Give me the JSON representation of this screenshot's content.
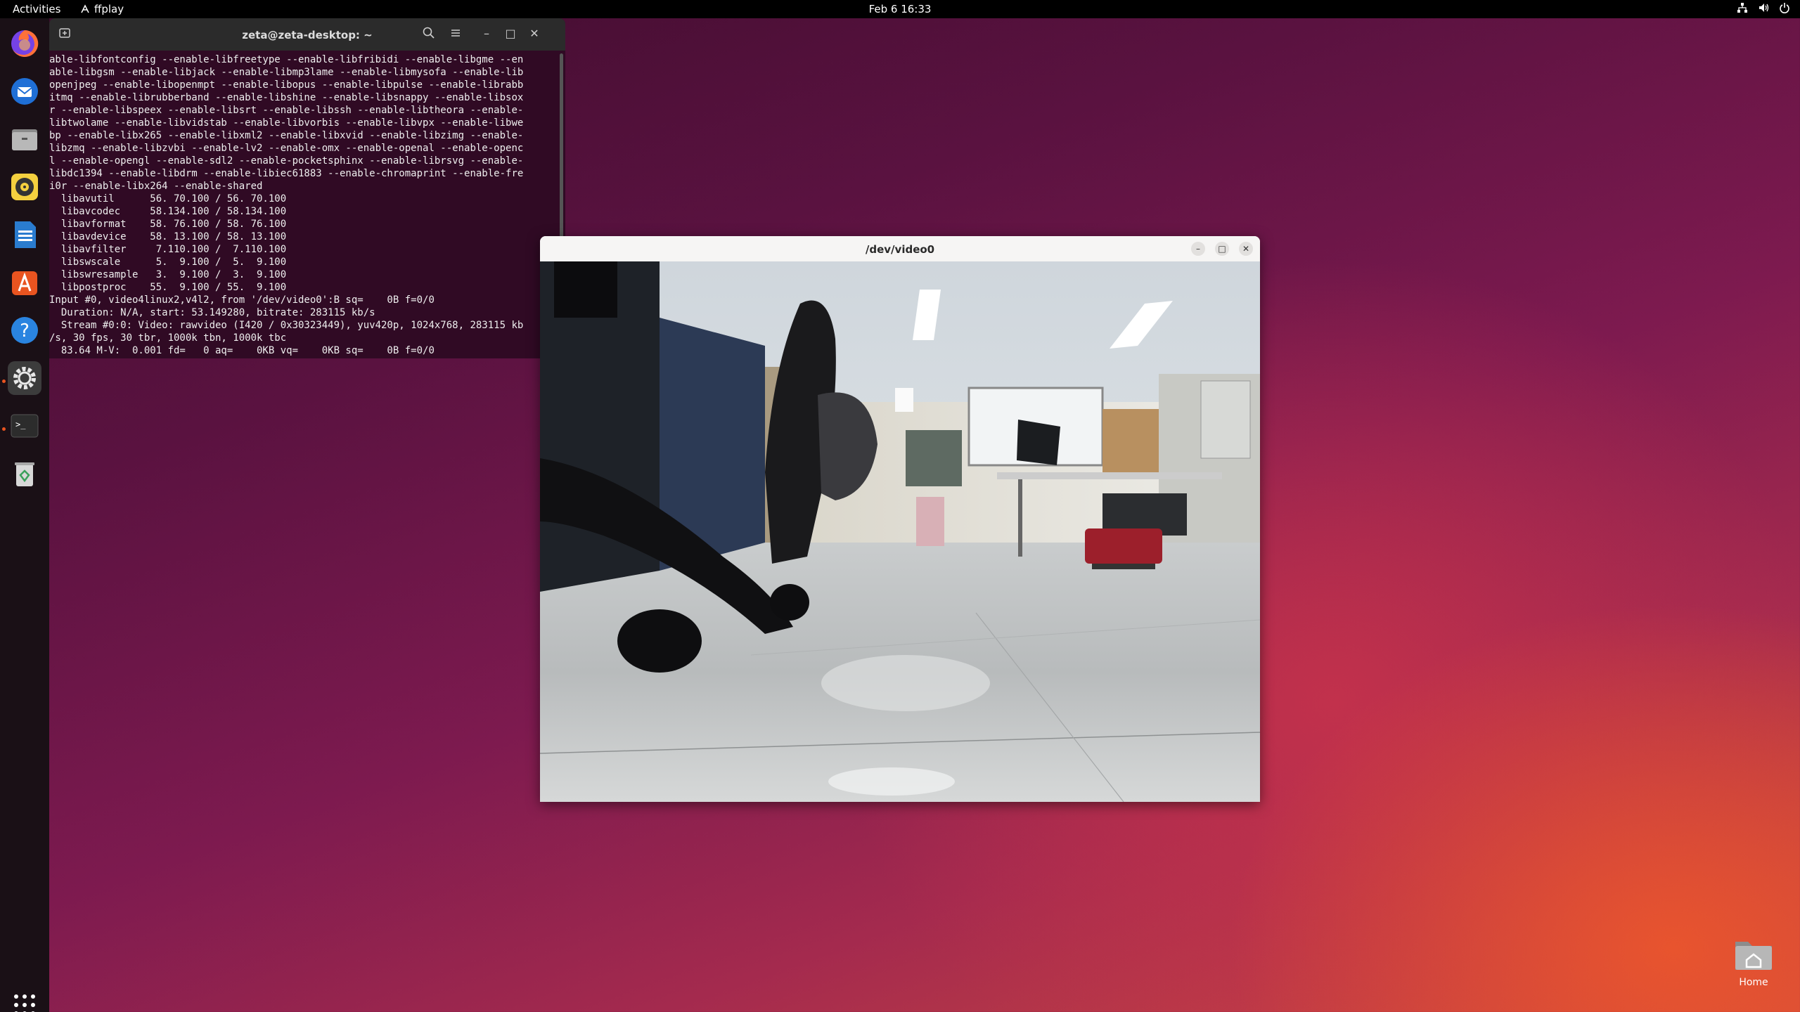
{
  "topbar": {
    "activities": "Activities",
    "app_name": "ffplay",
    "clock": "Feb 6  16:33"
  },
  "dock": {
    "items": [
      {
        "name": "firefox-icon"
      },
      {
        "name": "thunderbird-icon"
      },
      {
        "name": "files-icon"
      },
      {
        "name": "rhythmbox-icon"
      },
      {
        "name": "writer-icon"
      },
      {
        "name": "software-icon"
      },
      {
        "name": "help-icon"
      },
      {
        "name": "settings-icon"
      },
      {
        "name": "terminal-icon"
      },
      {
        "name": "trash-icon"
      }
    ]
  },
  "terminal": {
    "title": "zeta@zeta-desktop: ~",
    "lines": [
      "able-libfontconfig --enable-libfreetype --enable-libfribidi --enable-libgme --en",
      "able-libgsm --enable-libjack --enable-libmp3lame --enable-libmysofa --enable-lib",
      "openjpeg --enable-libopenmpt --enable-libopus --enable-libpulse --enable-librabb",
      "itmq --enable-librubberband --enable-libshine --enable-libsnappy --enable-libsox",
      "r --enable-libspeex --enable-libsrt --enable-libssh --enable-libtheora --enable-",
      "libtwolame --enable-libvidstab --enable-libvorbis --enable-libvpx --enable-libwe",
      "bp --enable-libx265 --enable-libxml2 --enable-libxvid --enable-libzimg --enable-",
      "libzmq --enable-libzvbi --enable-lv2 --enable-omx --enable-openal --enable-openc",
      "l --enable-opengl --enable-sdl2 --enable-pocketsphinx --enable-librsvg --enable-",
      "libdc1394 --enable-libdrm --enable-libiec61883 --enable-chromaprint --enable-fre",
      "i0r --enable-libx264 --enable-shared",
      "  libavutil      56. 70.100 / 56. 70.100",
      "  libavcodec     58.134.100 / 58.134.100",
      "  libavformat    58. 76.100 / 58. 76.100",
      "  libavdevice    58. 13.100 / 58. 13.100",
      "  libavfilter     7.110.100 /  7.110.100",
      "  libswscale      5.  9.100 /  5.  9.100",
      "  libswresample   3.  9.100 /  3.  9.100",
      "  libpostproc    55.  9.100 / 55.  9.100",
      "Input #0, video4linux2,v4l2, from '/dev/video0':B sq=    0B f=0/0",
      "  Duration: N/A, start: 53.149280, bitrate: 283115 kb/s",
      "  Stream #0:0: Video: rawvideo (I420 / 0x30323449), yuv420p, 1024x768, 283115 kb",
      "/s, 30 fps, 30 tbr, 1000k tbn, 1000k tbc",
      "  83.64 M-V:  0.001 fd=   0 aq=    0KB vq=    0KB sq=    0B f=0/0"
    ]
  },
  "video_window": {
    "title": "/dev/video0"
  },
  "desktop": {
    "home_label": "Home"
  },
  "colors": {
    "terminal_bg": "#300a24",
    "accent": "#e95420"
  }
}
